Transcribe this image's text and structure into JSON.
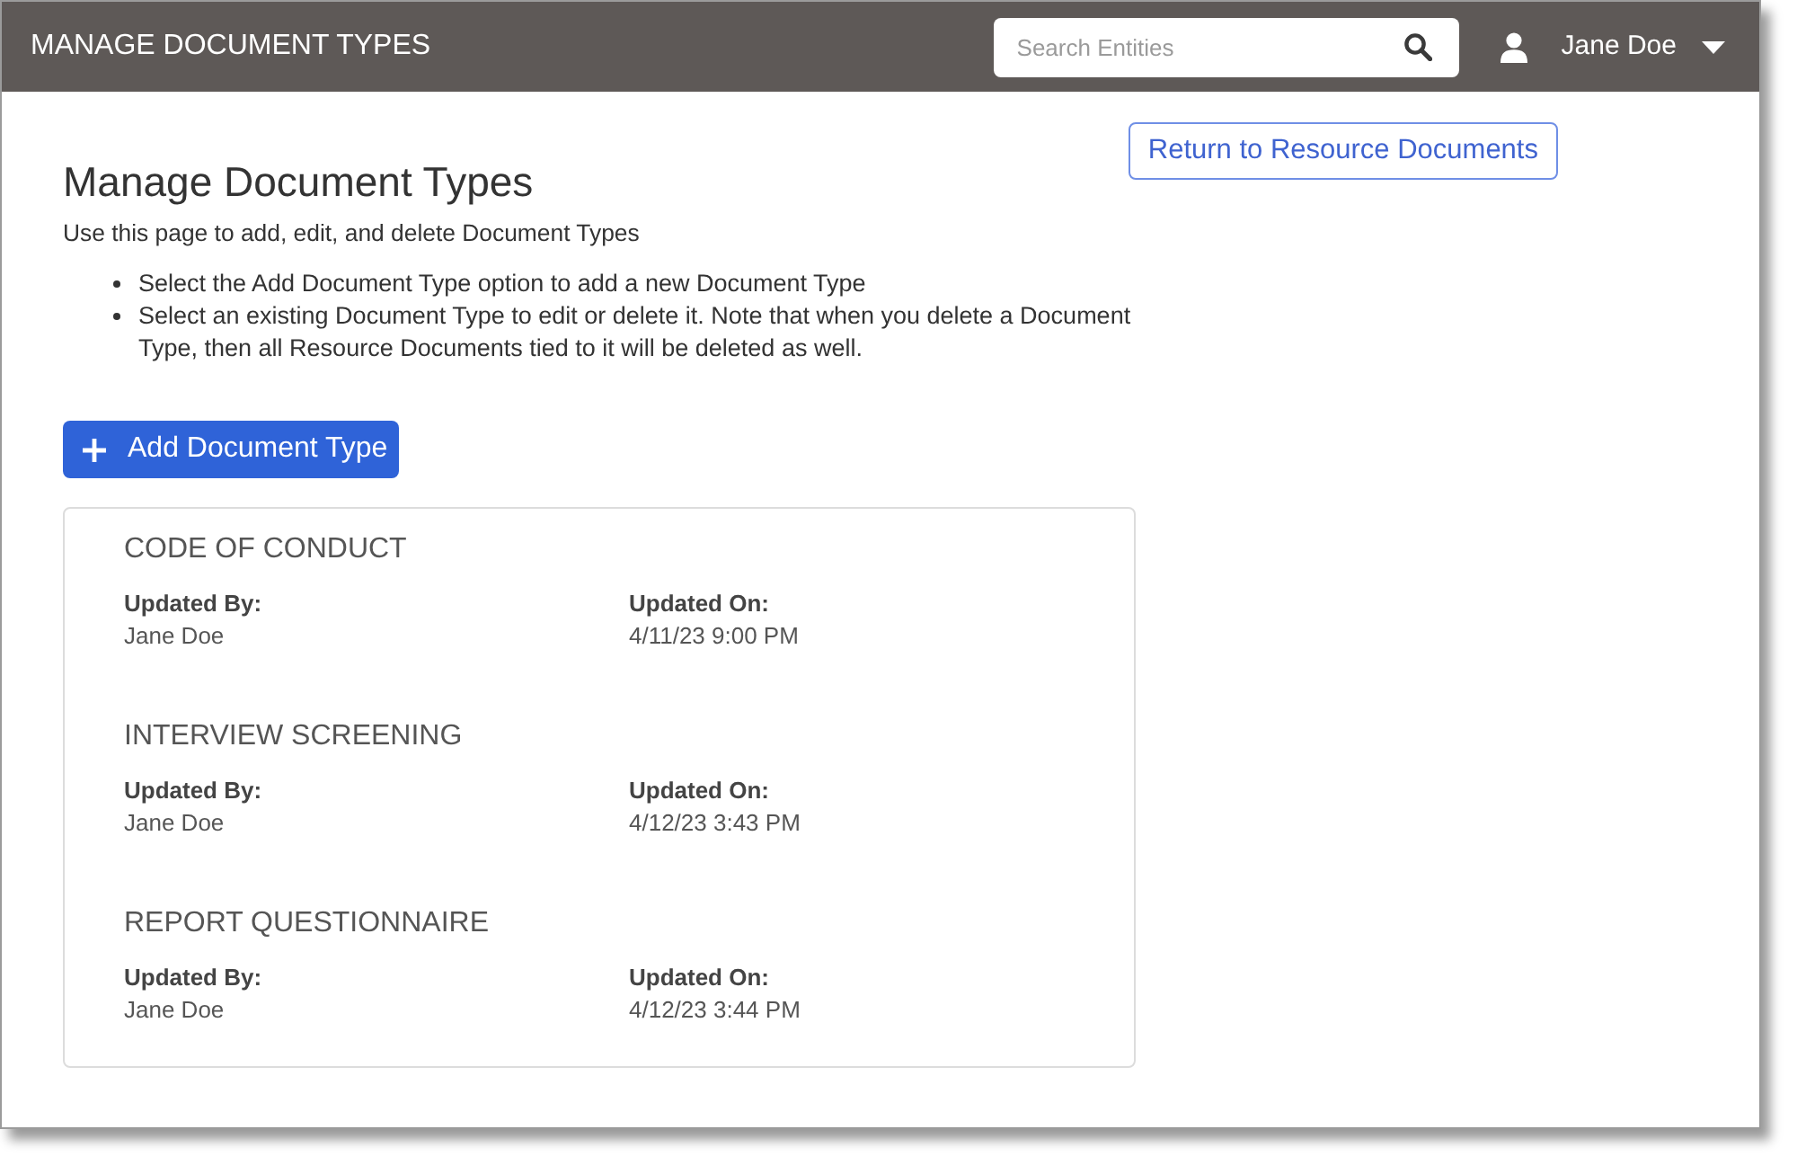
{
  "header": {
    "title": "MANAGE DOCUMENT TYPES",
    "search": {
      "placeholder": "Search Entities"
    },
    "user": {
      "name": "Jane Doe"
    }
  },
  "page": {
    "return_button": "Return to Resource Documents",
    "heading": "Manage Document Types",
    "intro": "Use this page to add, edit, and delete Document Types",
    "instructions": [
      "Select the Add Document Type option to add a new Document Type",
      "Select an existing Document Type to edit or delete it. Note that when you delete a Document Type, then all Resource Documents tied to it will be deleted as well."
    ],
    "add_button": "Add Document Type"
  },
  "document_types": [
    {
      "name": "CODE OF CONDUCT",
      "fields": [
        {
          "label": "Updated By:",
          "value": "Jane Doe"
        },
        {
          "label": "Updated On:",
          "value": "4/11/23 9:00 PM"
        }
      ]
    },
    {
      "name": "INTERVIEW SCREENING",
      "fields": [
        {
          "label": "Updated By:",
          "value": "Jane Doe"
        },
        {
          "label": "Updated On:",
          "value": "4/12/23 3:43 PM"
        }
      ]
    },
    {
      "name": "REPORT QUESTIONNAIRE",
      "fields": [
        {
          "label": "Updated By:",
          "value": "Jane Doe"
        },
        {
          "label": "Updated On:",
          "value": "4/12/23 3:44 PM"
        }
      ]
    }
  ]
}
